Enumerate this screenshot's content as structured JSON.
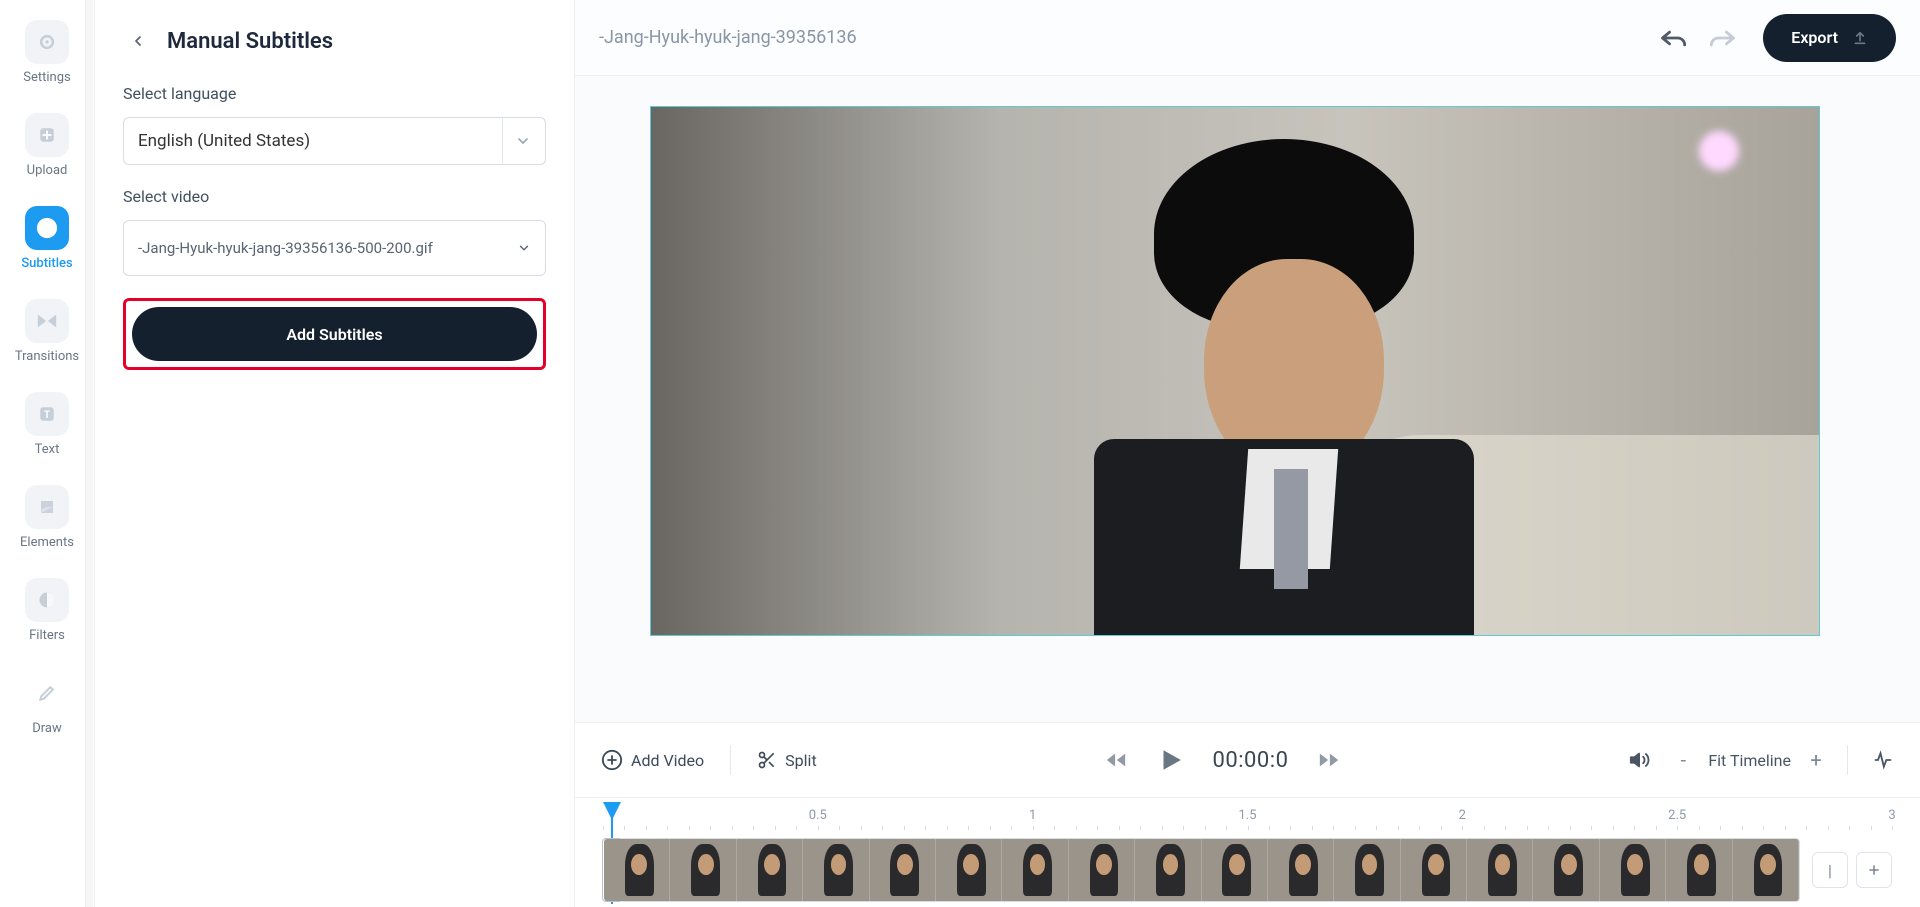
{
  "rail": {
    "items": [
      {
        "label": "Settings",
        "icon": "settings"
      },
      {
        "label": "Upload",
        "icon": "upload"
      },
      {
        "label": "Subtitles",
        "icon": "subtitles",
        "active": true
      },
      {
        "label": "Transitions",
        "icon": "transitions"
      },
      {
        "label": "Text",
        "icon": "text"
      },
      {
        "label": "Elements",
        "icon": "elements"
      },
      {
        "label": "Filters",
        "icon": "filters"
      },
      {
        "label": "Draw",
        "icon": "draw"
      }
    ]
  },
  "panel": {
    "title": "Manual Subtitles",
    "language_label": "Select language",
    "language_value": "English (United States)",
    "video_label": "Select video",
    "video_value": "-Jang-Hyuk-hyuk-jang-39356136-500-200.gif",
    "add_button": "Add Subtitles"
  },
  "topbar": {
    "filename": "-Jang-Hyuk-hyuk-jang-39356136",
    "export_label": "Export"
  },
  "player": {
    "add_video_label": "Add Video",
    "split_label": "Split",
    "timecode": "00:00:0",
    "fit_timeline_label": "Fit Timeline"
  },
  "timeline": {
    "tick_labels": [
      "0.5",
      "1",
      "1.5",
      "2",
      "2.5",
      "3"
    ],
    "thumb_count": 18
  }
}
